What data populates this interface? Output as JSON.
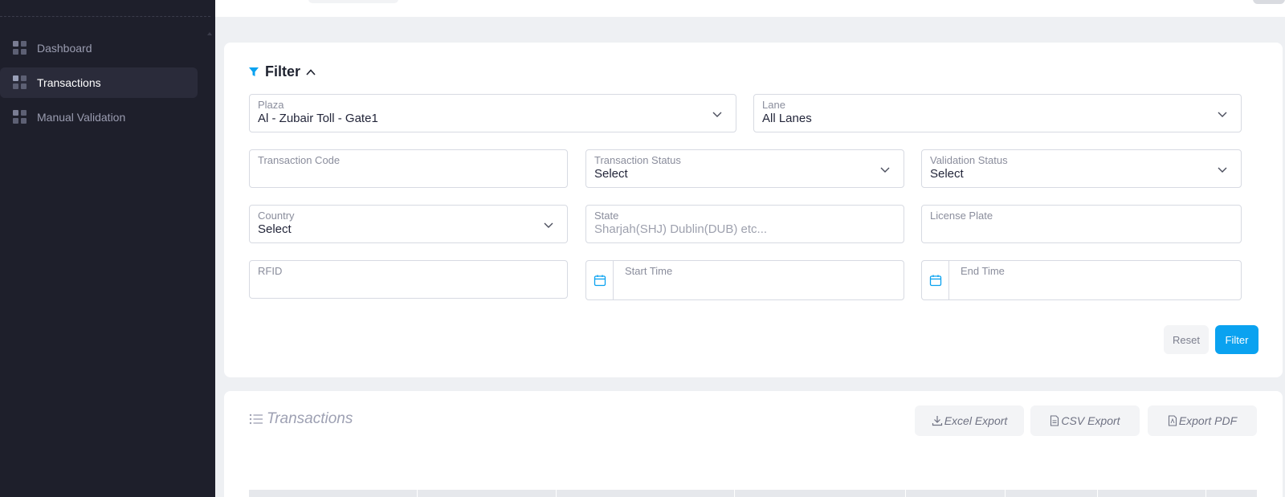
{
  "sidebar": {
    "items": [
      {
        "label": "Dashboard",
        "active": false
      },
      {
        "label": "Transactions",
        "active": true
      },
      {
        "label": "Manual Validation",
        "active": false
      }
    ]
  },
  "filter": {
    "title": "Filter",
    "fields": {
      "plaza": {
        "label": "Plaza",
        "value": "Al - Zubair Toll - Gate1"
      },
      "lane": {
        "label": "Lane",
        "value": "All Lanes"
      },
      "transaction_code": {
        "label": "Transaction Code",
        "value": ""
      },
      "transaction_status": {
        "label": "Transaction Status",
        "value": "Select"
      },
      "validation_status": {
        "label": "Validation Status",
        "value": "Select"
      },
      "country": {
        "label": "Country",
        "value": "Select"
      },
      "state": {
        "label": "State",
        "placeholder": "Sharjah(SHJ) Dublin(DUB) etc..."
      },
      "license_plate": {
        "label": "License Plate",
        "value": ""
      },
      "rfid": {
        "label": "RFID",
        "value": ""
      },
      "start_time": {
        "label": "Start Time",
        "value": ""
      },
      "end_time": {
        "label": "End Time",
        "value": ""
      }
    },
    "reset_label": "Reset",
    "filter_label": "Filter"
  },
  "transactions": {
    "title": "Transactions",
    "excel_export": "Excel Export",
    "csv_export": "CSV Export",
    "pdf_export": "Export PDF"
  },
  "colors": {
    "accent": "#0aa2f0",
    "sidebar_bg": "#1e1f2b",
    "sidebar_active": "#2a2b3a"
  }
}
